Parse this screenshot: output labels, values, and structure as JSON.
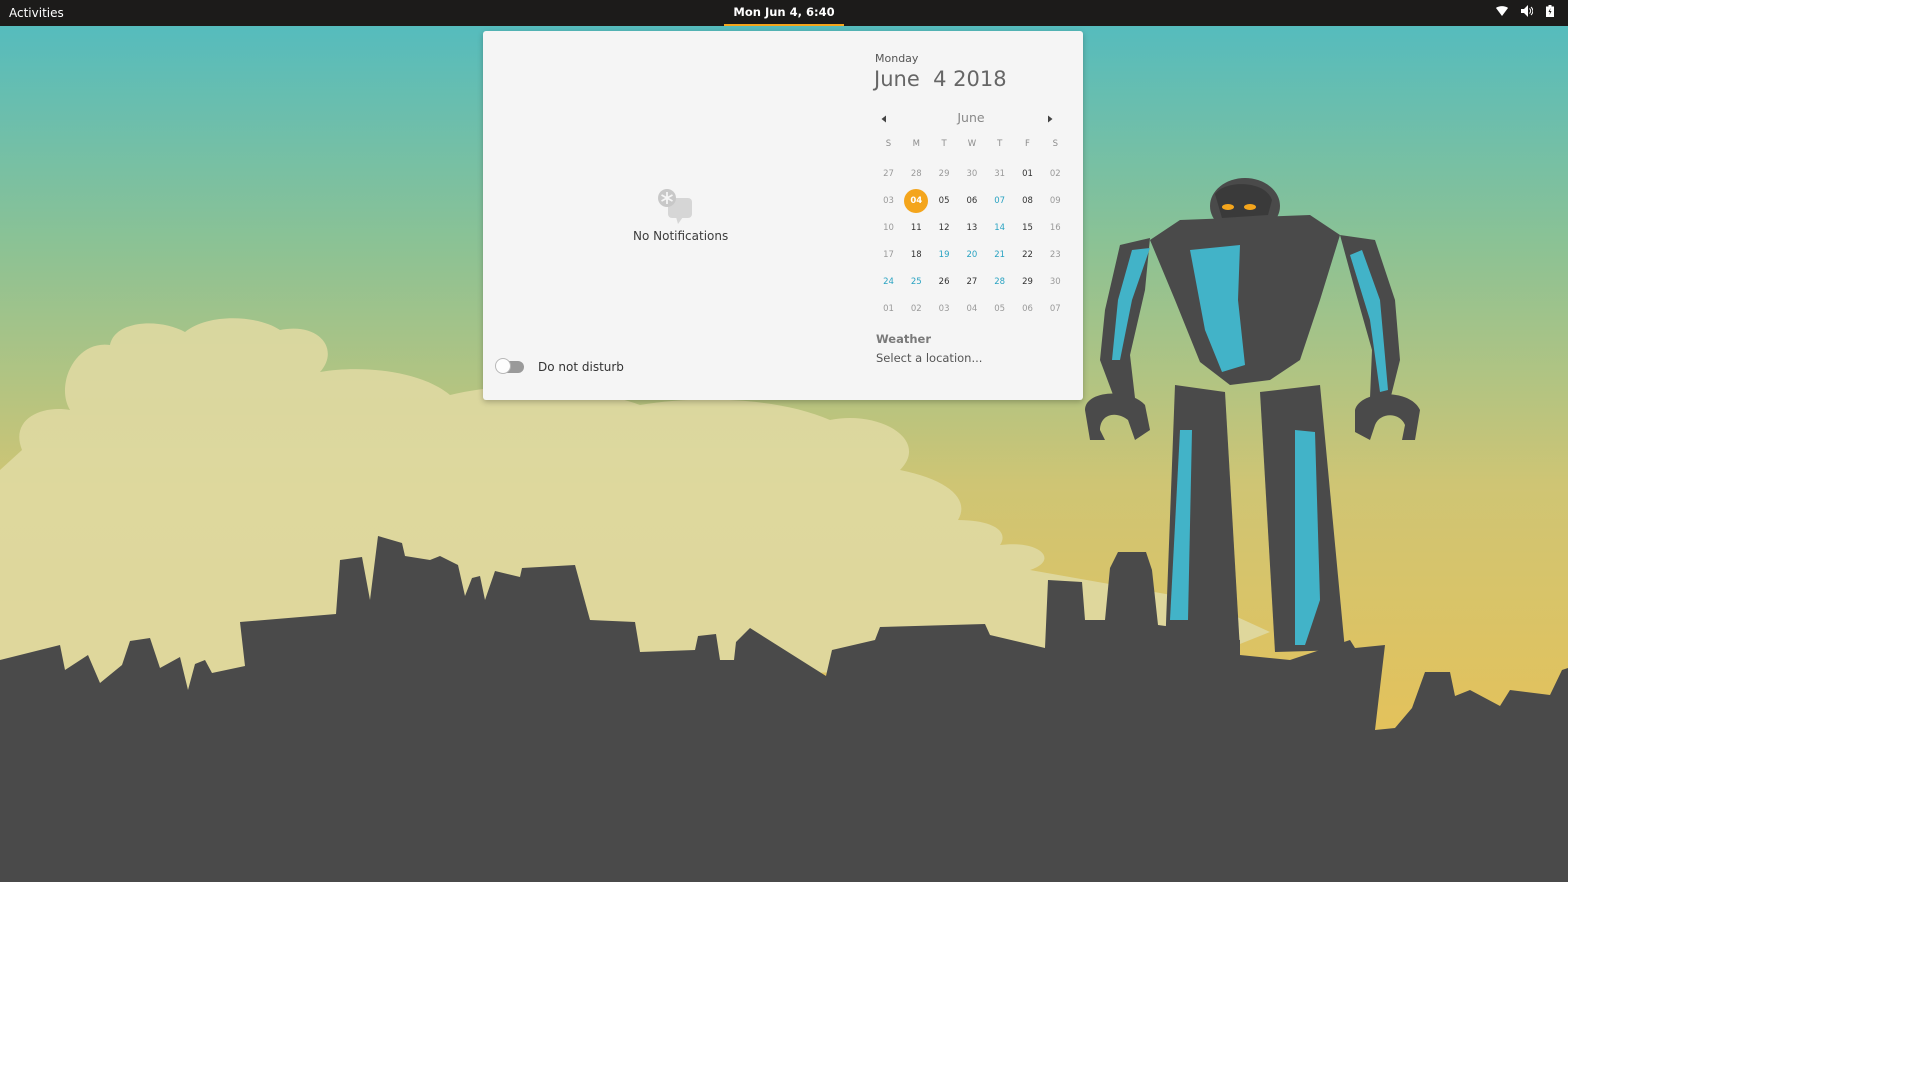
{
  "topbar": {
    "activities_label": "Activities",
    "clock_label": "Mon Jun  4, 6:40 AM",
    "tray_icons": [
      "wifi-icon",
      "volume-icon",
      "battery-icon"
    ]
  },
  "notifications": {
    "empty_label": "No Notifications",
    "dnd_label": "Do not disturb",
    "dnd_enabled": false
  },
  "calendar": {
    "day_name": "Monday",
    "full_date": "June  4 2018",
    "month_label": "June",
    "weekday_headers": [
      "S",
      "M",
      "T",
      "W",
      "T",
      "F",
      "S"
    ],
    "weeks": [
      [
        {
          "d": "27",
          "s": "dim"
        },
        {
          "d": "28",
          "s": "dim"
        },
        {
          "d": "29",
          "s": "dim"
        },
        {
          "d": "30",
          "s": "dim"
        },
        {
          "d": "31",
          "s": "dim"
        },
        {
          "d": "01",
          "s": "cur"
        },
        {
          "d": "02",
          "s": "dim"
        }
      ],
      [
        {
          "d": "03",
          "s": "dim"
        },
        {
          "d": "04",
          "s": "today"
        },
        {
          "d": "05",
          "s": "cur"
        },
        {
          "d": "06",
          "s": "cur"
        },
        {
          "d": "07",
          "s": "event"
        },
        {
          "d": "08",
          "s": "cur"
        },
        {
          "d": "09",
          "s": "dim"
        }
      ],
      [
        {
          "d": "10",
          "s": "dim"
        },
        {
          "d": "11",
          "s": "cur"
        },
        {
          "d": "12",
          "s": "cur"
        },
        {
          "d": "13",
          "s": "cur"
        },
        {
          "d": "14",
          "s": "event"
        },
        {
          "d": "15",
          "s": "cur"
        },
        {
          "d": "16",
          "s": "dim"
        }
      ],
      [
        {
          "d": "17",
          "s": "dim"
        },
        {
          "d": "18",
          "s": "cur"
        },
        {
          "d": "19",
          "s": "event"
        },
        {
          "d": "20",
          "s": "event"
        },
        {
          "d": "21",
          "s": "event"
        },
        {
          "d": "22",
          "s": "cur"
        },
        {
          "d": "23",
          "s": "dim"
        }
      ],
      [
        {
          "d": "24",
          "s": "event"
        },
        {
          "d": "25",
          "s": "event"
        },
        {
          "d": "26",
          "s": "cur"
        },
        {
          "d": "27",
          "s": "cur"
        },
        {
          "d": "28",
          "s": "event"
        },
        {
          "d": "29",
          "s": "cur"
        },
        {
          "d": "30",
          "s": "dim"
        }
      ],
      [
        {
          "d": "01",
          "s": "dim"
        },
        {
          "d": "02",
          "s": "dim"
        },
        {
          "d": "03",
          "s": "dim"
        },
        {
          "d": "04",
          "s": "dim"
        },
        {
          "d": "05",
          "s": "dim"
        },
        {
          "d": "06",
          "s": "dim"
        },
        {
          "d": "07",
          "s": "dim"
        }
      ]
    ]
  },
  "weather": {
    "title": "Weather",
    "location_prompt": "Select a location..."
  },
  "colors": {
    "accent": "#f4a51c",
    "event": "#2aa3c2",
    "topbar": "#1c1b1a",
    "popover": "#f5f5f5",
    "robot_blue": "#42b3c8",
    "silhouette": "#4a4a4a"
  }
}
